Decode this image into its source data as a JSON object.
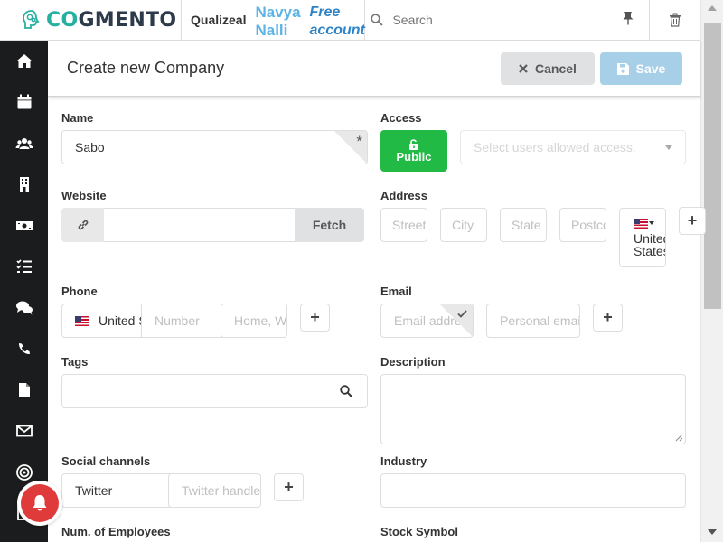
{
  "topbar": {
    "logo_prefix": "CO",
    "logo_rest": "GMENTO",
    "company": "Qualizeal",
    "user_first": "Navya",
    "user_last": "Nalli",
    "plan_line1": "Free",
    "plan_line2": "account",
    "search_placeholder": "Search"
  },
  "sidebar": {
    "icons": [
      "home-icon",
      "calendar-icon",
      "contacts-icon",
      "companies-icon",
      "deals-icon",
      "tasks-icon",
      "cases-icon",
      "calls-icon",
      "documents-icon",
      "email-icon",
      "campaigns-icon",
      "forms-icon"
    ]
  },
  "header": {
    "title": "Create new Company",
    "cancel_label": "Cancel",
    "save_label": "Save"
  },
  "form": {
    "name": {
      "label": "Name",
      "value": "Sabo",
      "required_mark": "*"
    },
    "access": {
      "label": "Access",
      "public_label": "Public",
      "users_placeholder": "Select users allowed access."
    },
    "website": {
      "label": "Website",
      "fetch_label": "Fetch",
      "value": ""
    },
    "address": {
      "label": "Address",
      "street_placeholder": "Street",
      "city_placeholder": "City",
      "state_placeholder": "State",
      "postcode_placeholder": "Postcode",
      "country_line1": "United",
      "country_line2": "States",
      "add_label": "+"
    },
    "phone": {
      "label": "Phone",
      "country": "United States",
      "number_placeholder": "Number",
      "type_placeholder": "Home, Work",
      "add_label": "+"
    },
    "email": {
      "label": "Email",
      "address_placeholder": "Email address",
      "personal_placeholder": "Personal email",
      "add_label": "+"
    },
    "tags": {
      "label": "Tags"
    },
    "description": {
      "label": "Description"
    },
    "social": {
      "label": "Social channels",
      "channel": "Twitter",
      "handle_placeholder": "Twitter handle",
      "add_label": "+"
    },
    "industry": {
      "label": "Industry"
    },
    "employees": {
      "label": "Num. of Employees"
    },
    "stock": {
      "label": "Stock Symbol"
    }
  },
  "colors": {
    "sidebar_bg": "#1b1c1d",
    "public_green": "#21ba45",
    "save_blue": "#a8cfe8",
    "logo_teal": "#25b0a0",
    "notify_red": "#e03b3b"
  }
}
